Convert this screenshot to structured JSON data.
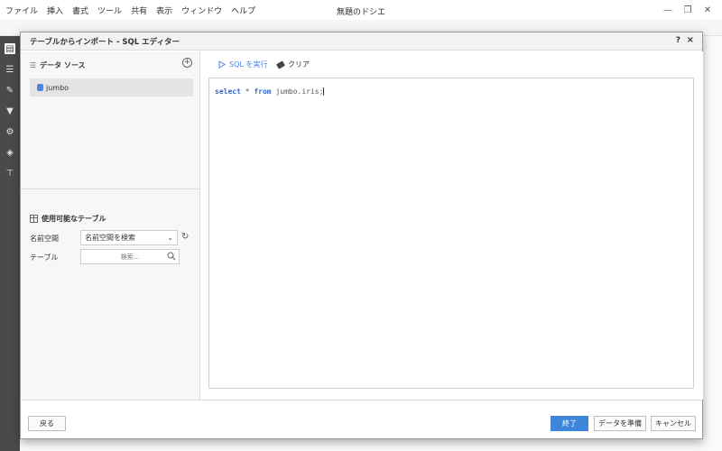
{
  "menu": [
    "ファイル",
    "挿入",
    "書式",
    "ツール",
    "共有",
    "表示",
    "ウィンドウ",
    "ヘルプ"
  ],
  "app_title": "無題のドシエ",
  "window_controls": {
    "minimize": "—",
    "restore": "❐",
    "close": "✕"
  },
  "modal": {
    "title": "テーブルからインポート - SQL エディター",
    "help": "?",
    "close": "×"
  },
  "datasource": {
    "header": "データ ソース",
    "add_icon": "+",
    "items": [
      {
        "label": "jumbo"
      }
    ]
  },
  "tables": {
    "header": "使用可能なテーブル",
    "namespace_label": "名前空間",
    "namespace_value": "名前空間を検索",
    "table_label": "テーブル",
    "table_search_placeholder": "検索..."
  },
  "editor_toolbar": {
    "run_label": "SQL を実行",
    "clear_label": "クリア"
  },
  "editor": {
    "kw_select": "select",
    "star": " * ",
    "kw_from": "from",
    "rest": " jumbo.iris;"
  },
  "footer": {
    "back": "戻る",
    "finish": "終了",
    "prepare": "データを準備",
    "cancel": "キャンセル"
  },
  "colors": {
    "accent": "#3d85d8",
    "keyword": "#3366cc"
  }
}
